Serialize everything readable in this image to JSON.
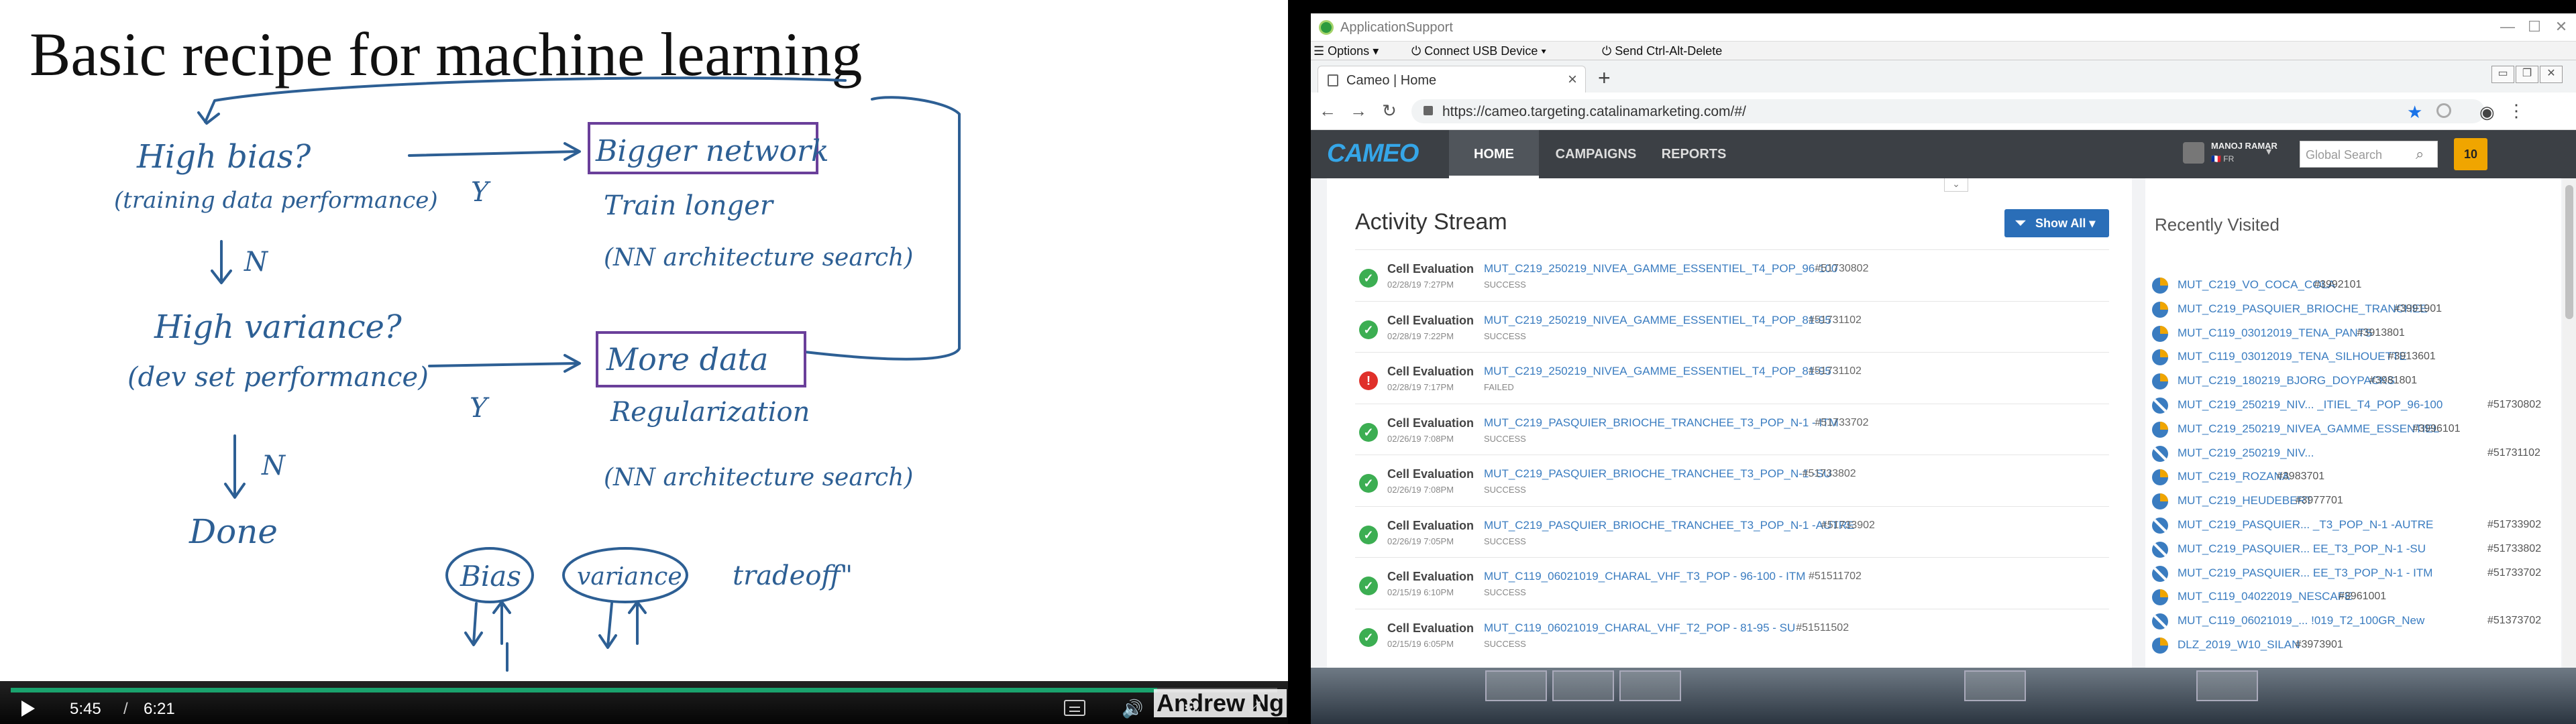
{
  "video": {
    "slide_title": "Basic recipe for machine learning",
    "handwriting": {
      "high_bias": "High bias?",
      "training_perf": "(training data performance)",
      "n1": "N",
      "bigger_network": "Bigger network",
      "train_longer": "Train longer",
      "nn_search1": "(NN architecture search)",
      "y1": "Y",
      "high_variance": "High variance?",
      "dev_perf": "(dev set performance)",
      "more_data": "More data",
      "regularization": "Regularization",
      "nn_search2": "(NN architecture search)",
      "y2": "Y",
      "n2": "N",
      "done": "Done",
      "bias": "Bias",
      "variance": "variance",
      "tradeoff": "tradeoff\""
    },
    "current_time": "5:45",
    "duration": "6:21",
    "progress_fraction": 0.905,
    "watermark": "Andrew Ng"
  },
  "remote": {
    "app_title": "ApplicationSupport",
    "toolbar": {
      "options": "Options",
      "connect_usb": "Connect USB Device",
      "send_cad": "Send Ctrl-Alt-Delete"
    }
  },
  "browser": {
    "tab_title": "Cameo | Home",
    "url": "https://cameo.targeting.catalinamarketing.com/#/"
  },
  "cameo": {
    "logo": "CAMEO",
    "nav": [
      "HOME",
      "CAMPAIGNS",
      "REPORTS"
    ],
    "user_name": "MANOJ RAMAR",
    "user_locale": "FR",
    "search_placeholder": "Global Search",
    "notification_count": "10",
    "activity_title": "Activity Stream",
    "show_all": "Show All",
    "recent_title": "Recently Visited",
    "stream": [
      {
        "type": "Cell Evaluation",
        "name": "MUT_C219_250219_NIVEA_GAMME_ESSENTIEL_T4_POP_96-100",
        "id": "#51730802",
        "date": "02/28/19 7:27PM",
        "status": "SUCCESS",
        "ok": true
      },
      {
        "type": "Cell Evaluation",
        "name": "MUT_C219_250219_NIVEA_GAMME_ESSENTIEL_T4_POP_81-95",
        "id": "#51731102",
        "date": "02/28/19 7:22PM",
        "status": "SUCCESS",
        "ok": true
      },
      {
        "type": "Cell Evaluation",
        "name": "MUT_C219_250219_NIVEA_GAMME_ESSENTIEL_T4_POP_81-95",
        "id": "#51731102",
        "date": "02/28/19 7:17PM",
        "status": "FAILED",
        "ok": false
      },
      {
        "type": "Cell Evaluation",
        "name": "MUT_C219_PASQUIER_BRIOCHE_TRANCHEE_T3_POP_N-1 - ITM",
        "id": "#51733702",
        "date": "02/26/19 7:08PM",
        "status": "SUCCESS",
        "ok": true
      },
      {
        "type": "Cell Evaluation",
        "name": "MUT_C219_PASQUIER_BRIOCHE_TRANCHEE_T3_POP_N-1 -SU",
        "id": "#51733802",
        "date": "02/26/19 7:08PM",
        "status": "SUCCESS",
        "ok": true
      },
      {
        "type": "Cell Evaluation",
        "name": "MUT_C219_PASQUIER_BRIOCHE_TRANCHEE_T3_POP_N-1 -AUTRE",
        "id": "#51733902",
        "date": "02/26/19 7:05PM",
        "status": "SUCCESS",
        "ok": true
      },
      {
        "type": "Cell Evaluation",
        "name": "MUT_C119_06021019_CHARAL_VHF_T3_POP - 96-100 - ITM",
        "id": "#51511702",
        "date": "02/15/19 6:10PM",
        "status": "SUCCESS",
        "ok": true
      },
      {
        "type": "Cell Evaluation",
        "name": "MUT_C119_06021019_CHARAL_VHF_T2_POP - 81-95 - SU",
        "id": "#51511502",
        "date": "02/15/19 6:05PM",
        "status": "SUCCESS",
        "ok": true
      }
    ],
    "recent": [
      {
        "name": "MUT_C219_VO_COCA_COLA",
        "id": "#3992101",
        "icon": "pie"
      },
      {
        "name": "MUT_C219_PASQUIER_BRIOCHE_TRANCHEE",
        "id": "#3991901",
        "icon": "pie"
      },
      {
        "name": "MUT_C119_03012019_TENA_PANTS",
        "id": "#3913801",
        "icon": "pie"
      },
      {
        "name": "MUT_C119_03012019_TENA_SILHOUETTE",
        "id": "#3913601",
        "icon": "pie"
      },
      {
        "name": "MUT_C219_180219_BJORG_DOYPACKS",
        "id": "#3981801",
        "icon": "pie"
      },
      {
        "name": "MUT_C219_250219_NIV... _ITIEL_T4_POP_96-100",
        "id": "#51730802",
        "icon": "nope"
      },
      {
        "name": "MUT_C219_250219_NIVEA_GAMME_ESSENTIEL",
        "id": "#3996101",
        "icon": "pie"
      },
      {
        "name": "MUT_C219_250219_NIV...",
        "id": "#51731102",
        "icon": "nope"
      },
      {
        "name": "MUT_C219_ROZANA",
        "id": "#3983701",
        "icon": "pie"
      },
      {
        "name": "MUT_C219_HEUDEBERT",
        "id": "#3977701",
        "icon": "pie"
      },
      {
        "name": "MUT_C219_PASQUIER... _T3_POP_N-1 -AUTRE",
        "id": "#51733902",
        "icon": "nope"
      },
      {
        "name": "MUT_C219_PASQUIER... EE_T3_POP_N-1 -SU",
        "id": "#51733802",
        "icon": "nope"
      },
      {
        "name": "MUT_C219_PASQUIER... EE_T3_POP_N-1 - ITM",
        "id": "#51733702",
        "icon": "nope"
      },
      {
        "name": "MUT_C119_04022019_NESCAFE",
        "id": "#3961001",
        "icon": "pie"
      },
      {
        "name": "MUT_C119_06021019_... !019_T2_100GR_New",
        "id": "#51373702",
        "icon": "nope"
      },
      {
        "name": "DLZ_2019_W10_SILAN",
        "id": "#3973901",
        "icon": "pie"
      }
    ]
  }
}
